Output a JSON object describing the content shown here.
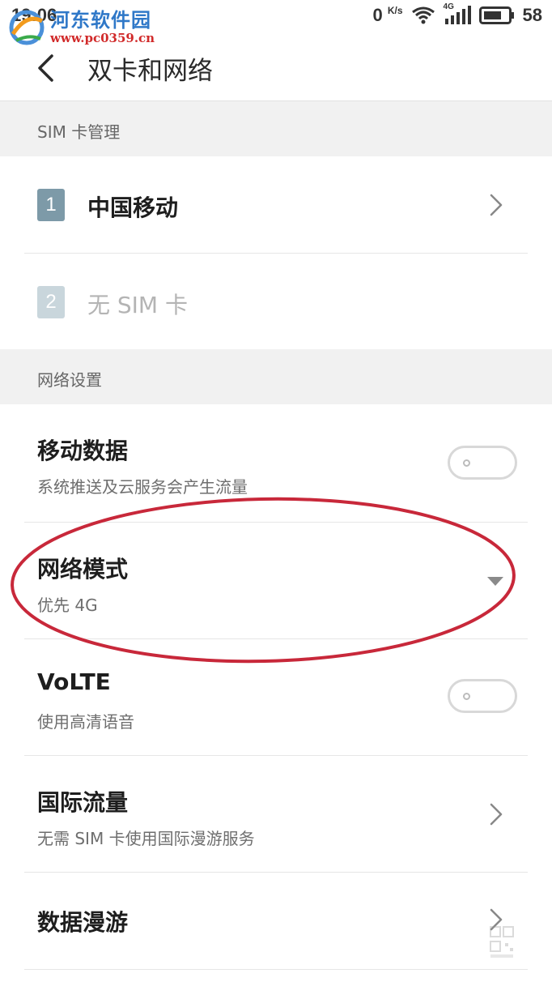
{
  "status_bar": {
    "time": "19:06",
    "net_speed": "0",
    "net_unit": "K/s",
    "signal_type": "4G",
    "battery": "58",
    "icons": [
      "wifi-icon",
      "cellular-signal-icon",
      "battery-icon"
    ]
  },
  "watermark": {
    "site_name": "河东软件园",
    "url": "www.pc0359.cn"
  },
  "header": {
    "title": "双卡和网络",
    "back_icon": "chevron-left-icon"
  },
  "sim_section": {
    "title": "SIM 卡管理",
    "items": [
      {
        "slot": "1",
        "label": "中国移动",
        "enabled": true
      },
      {
        "slot": "2",
        "label": "无 SIM 卡",
        "enabled": false
      }
    ]
  },
  "network_section": {
    "title": "网络设置",
    "items": [
      {
        "title": "移动数据",
        "subtitle": "系统推送及云服务会产生流量",
        "control": "toggle",
        "on": false
      },
      {
        "title": "网络模式",
        "subtitle": "优先 4G",
        "control": "dropdown"
      },
      {
        "title": "VoLTE",
        "subtitle": "使用高清语音",
        "control": "toggle",
        "on": false
      },
      {
        "title": "国际流量",
        "subtitle": "无需 SIM 卡使用国际漫游服务",
        "control": "chevron"
      },
      {
        "title": "数据漫游",
        "subtitle": "",
        "control": "chevron"
      }
    ]
  },
  "colors": {
    "sim1_badge": "#7d9aa8",
    "sim2_badge": "#c9d6dc",
    "highlight_ellipse": "#c8283a",
    "section_bg": "#f1f1f1"
  }
}
